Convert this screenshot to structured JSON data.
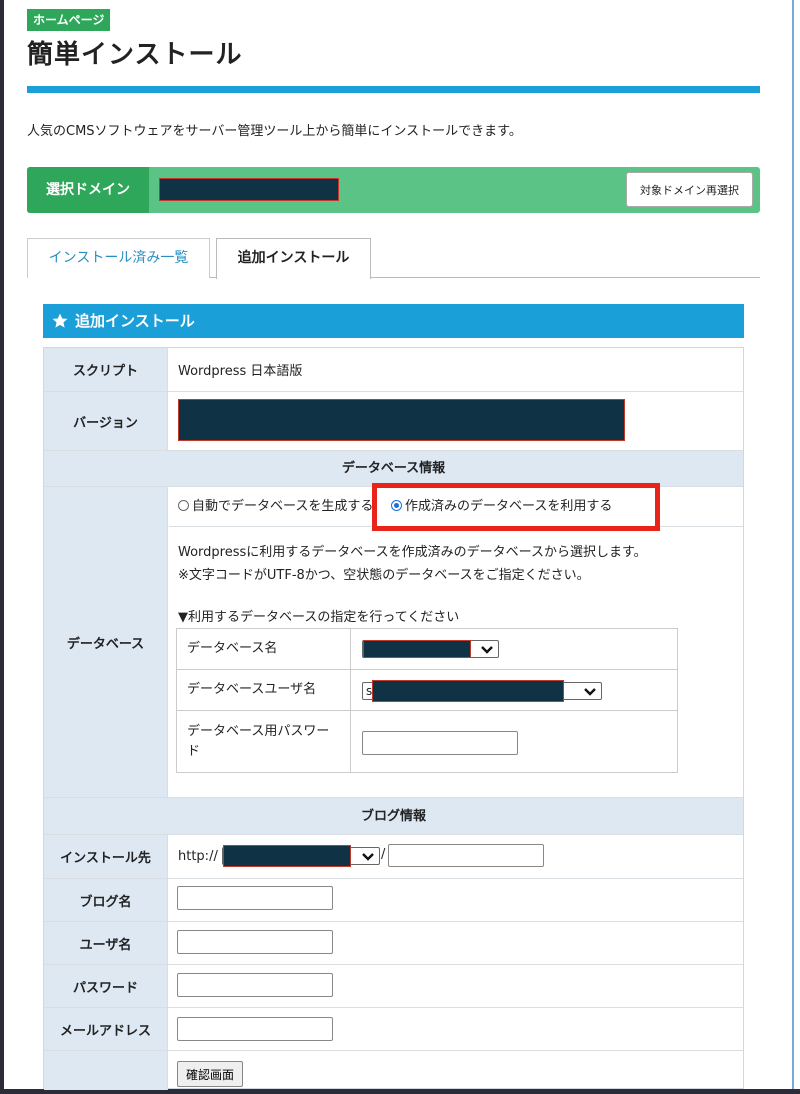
{
  "header": {
    "badge": "ホームページ",
    "title": "簡単インストール",
    "description": "人気のCMSソフトウェアをサーバー管理ツール上から簡単にインストールできます。"
  },
  "domain": {
    "label": "選択ドメイン",
    "reselect_label": "対象ドメイン再選択"
  },
  "tabs": [
    {
      "label": "インストール済み一覧",
      "active": false
    },
    {
      "label": "追加インストール",
      "active": true
    }
  ],
  "panel": {
    "title": "追加インストール",
    "icon": "star-icon"
  },
  "form": {
    "script_label": "スクリプト",
    "script_value": "Wordpress 日本語版",
    "version_label": "バージョン",
    "db_section": "データベース情報",
    "database_label": "データベース",
    "radio_auto": "自動でデータベースを生成する",
    "radio_existing": "作成済みのデータベースを利用する",
    "radio_selected": "existing",
    "db_note_1": "Wordpressに利用するデータベースを作成済みのデータベースから選択します。",
    "db_note_2": "※文字コードがUTF-8かつ、空状態のデータベースをご指定ください。",
    "db_instruction": "▼利用するデータベースの指定を行ってください",
    "db_name_label": "データベース名",
    "db_user_label": "データベースユーザ名",
    "db_user_prefix": "s",
    "db_password_label": "データベース用パスワード",
    "blog_section": "ブログ情報",
    "install_to_label": "インストール先",
    "install_prefix": "http://",
    "install_slash": "/",
    "blog_name_label": "ブログ名",
    "user_name_label": "ユーザ名",
    "password_label": "パスワード",
    "email_label": "メールアドレス",
    "confirm_label": "確認画面"
  },
  "colors": {
    "accent_blue": "#1a9fd9",
    "accent_green": "#2fa75b",
    "light_green": "#5cc386",
    "highlight_red": "#e8241a",
    "redaction": "#0f3245"
  }
}
